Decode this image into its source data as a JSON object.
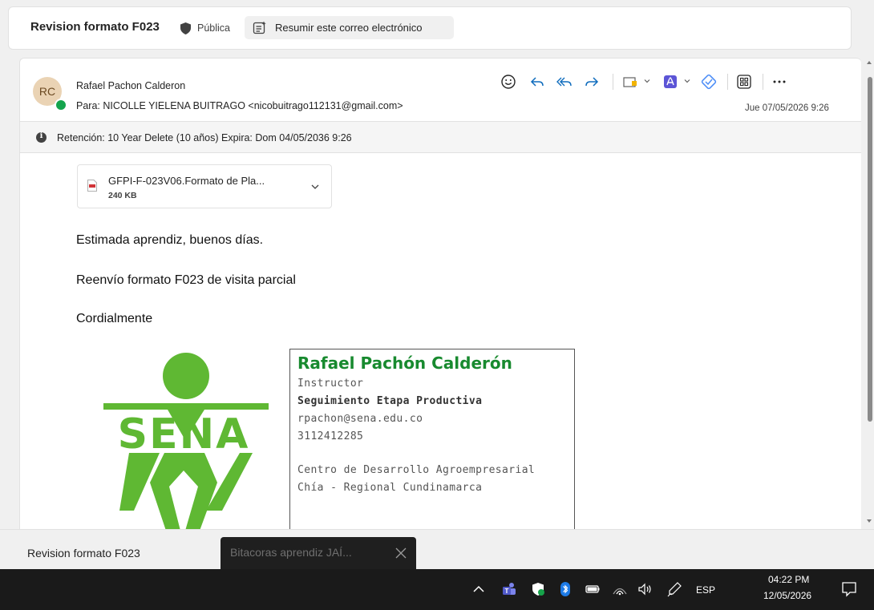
{
  "topbar": {
    "subject": "Revision formato F023",
    "visibility": "Pública",
    "summarize": "Resumir este correo electrónico"
  },
  "message": {
    "avatar_initials": "RC",
    "sender": "Rafael Pachon Calderon",
    "to": "Para:  NICOLLE YIELENA BUITRAGO <nicobuitrago112131@gmail.com>",
    "date": "Jue 07/05/2026 9:26",
    "retention": "Retención: 10 Year Delete (10 años) Expira: Dom 04/05/2036 9:26",
    "attachment": {
      "name": "GFPI-F-023V06.Formato de Pla...",
      "size": "240 KB"
    },
    "body": [
      "Estimada aprendiz, buenos días.",
      "Reenvío formato F023 de visita parcial",
      "Cordialmente"
    ]
  },
  "signature": {
    "logo_text": "SENA",
    "name": "Rafael Pachón Calderón",
    "title": "Instructor",
    "department": "Seguimiento Etapa Productiva",
    "email": "rpachon@sena.edu.co",
    "phone": "3112412285",
    "center": "Centro de Desarrollo Agroempresarial",
    "regional": "Chía - Regional Cundinamarca"
  },
  "bottom_tabs": {
    "active": "Revision formato F023",
    "toast": "Bitacoras aprendiz JAÍ..."
  },
  "taskbar": {
    "language": "ESP",
    "time": "04:22 PM",
    "date": "12/05/2026"
  },
  "colors": {
    "sena_green": "#5fb833",
    "sig_green": "#188a2f",
    "accent_blue": "#0f6cbd",
    "presence_green": "#14a44d"
  }
}
